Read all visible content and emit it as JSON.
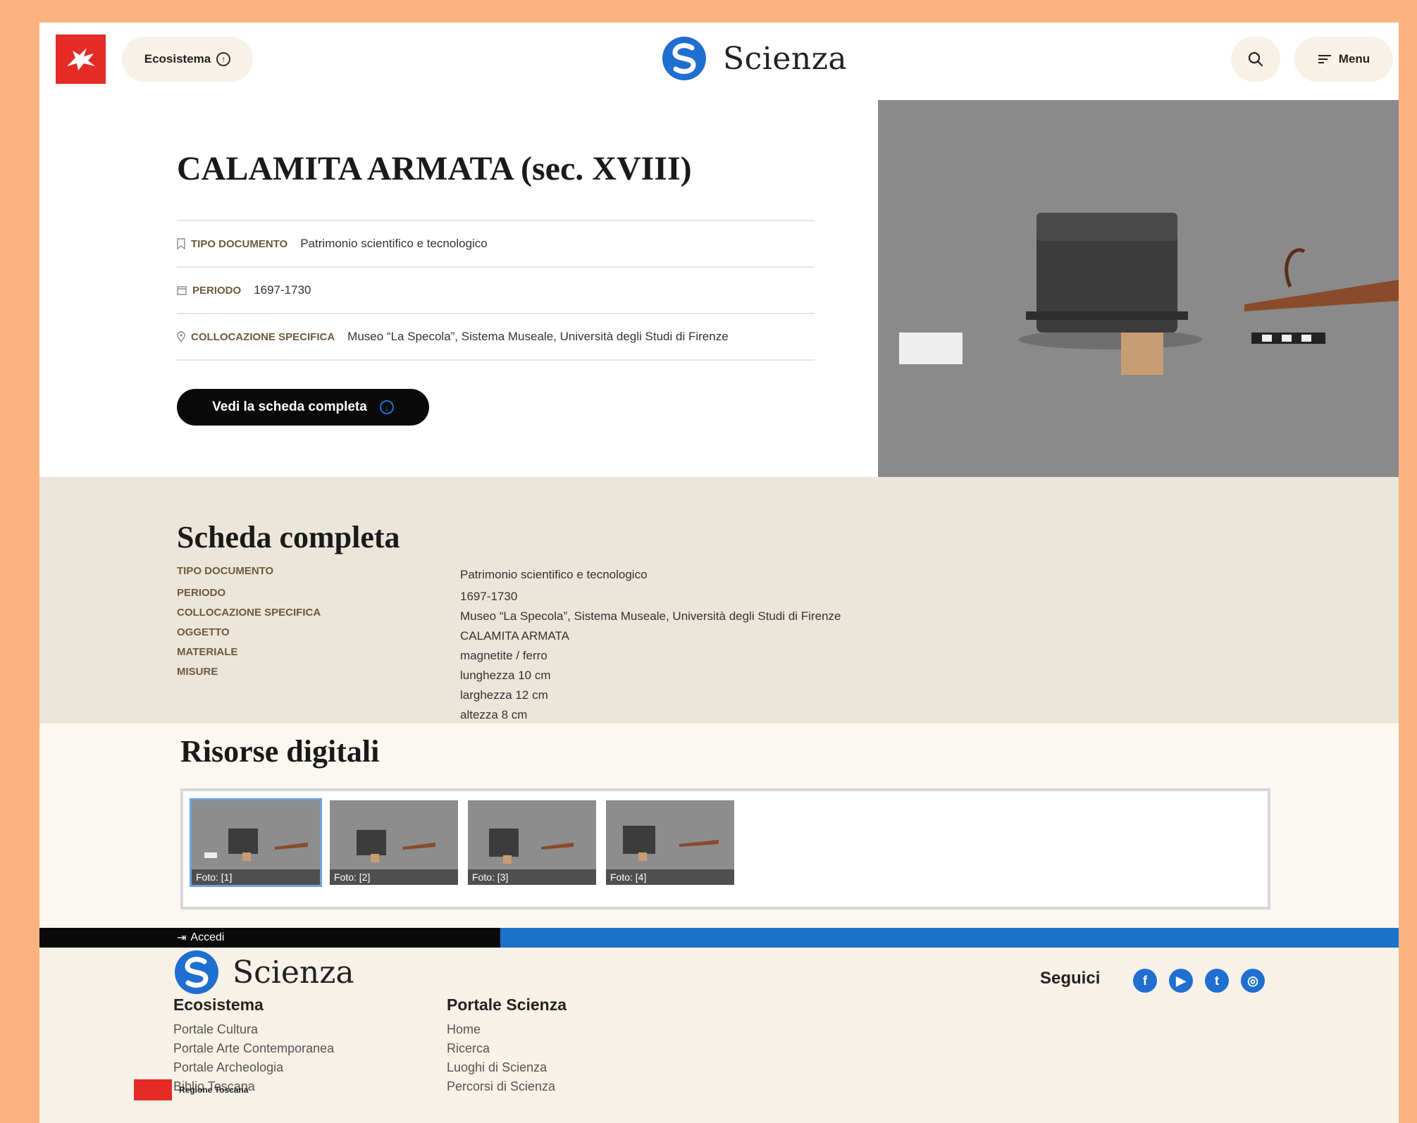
{
  "header": {
    "ecosistema_label": "Ecosistema",
    "brand": "Scienza",
    "menu_label": "Menu",
    "brand_color": "#1f6fd1",
    "accent_red": "#e42b26"
  },
  "hero": {
    "title": "CALAMITA ARMATA (sec. XVIII)",
    "meta": [
      {
        "icon": "bookmark-icon",
        "label": "TIPO DOCUMENTO",
        "value": "Patrimonio scientifico e tecnologico"
      },
      {
        "icon": "calendar-icon",
        "label": "PERIODO",
        "value": "1697-1730"
      },
      {
        "icon": "location-pin-icon",
        "label": "COLLOCAZIONE SPECIFICA",
        "value": "Museo “La Specola”, Sistema Museale, Università degli Studi di Firenze"
      }
    ],
    "cta_label": "Vedi la scheda completa"
  },
  "scheda": {
    "title": "Scheda completa",
    "rows": [
      {
        "label": "TIPO DOCUMENTO",
        "values": [
          "Patrimonio scientifico e tecnologico"
        ]
      },
      {
        "label": "PERIODO",
        "values": [
          "1697-1730"
        ]
      },
      {
        "label": "COLLOCAZIONE SPECIFICA",
        "values": [
          "Museo “La Specola”, Sistema Museale, Università degli Studi di Firenze"
        ]
      },
      {
        "label": "OGGETTO",
        "values": [
          "CALAMITA ARMATA"
        ]
      },
      {
        "label": "MATERIALE",
        "values": [
          "magnetite / ferro"
        ]
      },
      {
        "label": "MISURE",
        "values": [
          "lunghezza 10 cm",
          "larghezza 12 cm",
          "altezza 8 cm"
        ]
      }
    ]
  },
  "risorse": {
    "title": "Risorse digitali",
    "thumbs": [
      "Foto: [1]",
      "Foto: [2]",
      "Foto: [3]",
      "Foto: [4]"
    ]
  },
  "footer": {
    "accedi": "Accedi",
    "brand": "Scienza",
    "seguici": "Seguici",
    "col1_title": "Ecosistema",
    "col1_links": [
      "Portale Cultura",
      "Portale Arte Contemporanea",
      "Portale Archeologia",
      "Biblio Toscana"
    ],
    "col2_title": "Portale Scienza",
    "col2_links": [
      "Home",
      "Ricerca",
      "Luoghi di Scienza",
      "Percorsi di Scienza"
    ],
    "socials": [
      "facebook-icon",
      "youtube-icon",
      "twitter-icon",
      "instagram-icon"
    ],
    "regione": "Regione Toscana"
  }
}
